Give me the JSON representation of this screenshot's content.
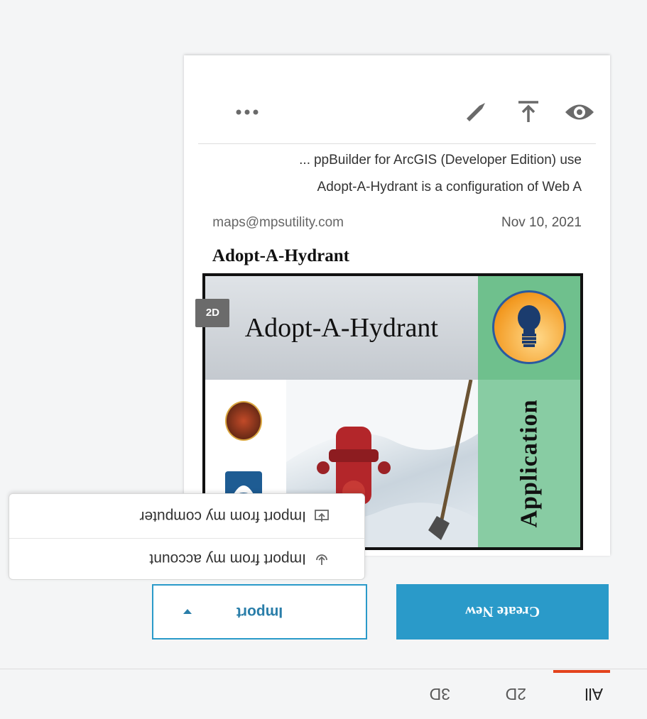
{
  "tabs": [
    {
      "label": "All"
    },
    {
      "label": "2D"
    },
    {
      "label": "3D"
    }
  ],
  "buttons": {
    "create_new": "Create New",
    "import": "Import"
  },
  "import_menu": [
    {
      "label": "Import from my account",
      "icon": "account-import-icon"
    },
    {
      "label": "Import from my computer",
      "icon": "computer-upload-icon"
    }
  ],
  "card": {
    "thumbnail": {
      "side_label": "Application",
      "banner_title": "Adopt-A-Hydrant",
      "badge": "2D"
    },
    "title": "Adopt-A-Hydrant",
    "date": "Nov 10, 2021",
    "owner": "maps@mpsutility.com",
    "description_line1": "Adopt-A-Hydrant is a configuration of Web A",
    "description_line2": "ppBuilder for ArcGIS (Developer Edition) use",
    "description_ellipsis": "...",
    "actions": [
      "view-icon",
      "share-icon",
      "edit-icon",
      "more-icon"
    ]
  },
  "colors": {
    "primary": "#2a9ac9",
    "tab_accent": "#e3431c",
    "thumb_green": "#88cca3"
  }
}
